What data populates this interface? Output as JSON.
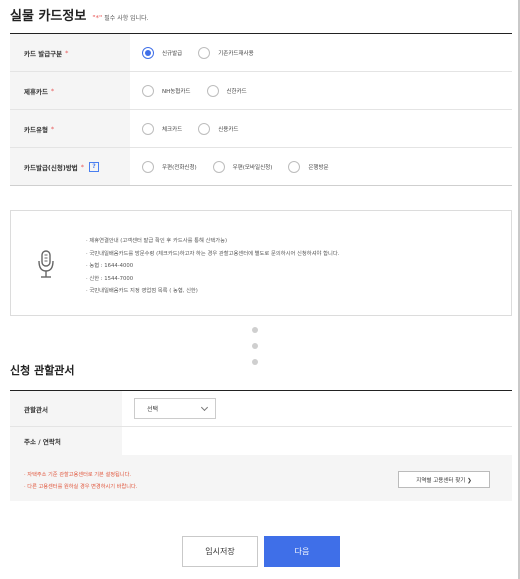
{
  "card_section": {
    "title": "실물 카드정보",
    "required_mark": "\"*\"",
    "required_text": "필수 사항 입니다."
  },
  "form_rows": [
    {
      "label": "카드 발급구분",
      "star": "*",
      "options": [
        {
          "label": "신규발급",
          "selected": true
        },
        {
          "label": "기존카드재사용",
          "selected": false
        }
      ]
    },
    {
      "label": "제휴카드",
      "star": "*",
      "options": [
        {
          "label": "NH농협카드",
          "selected": false
        },
        {
          "label": "신한카드",
          "selected": false
        }
      ]
    },
    {
      "label": "카드유형",
      "star": "*",
      "options": [
        {
          "label": "체크카드",
          "selected": false
        },
        {
          "label": "신용카드",
          "selected": false
        }
      ]
    },
    {
      "label": "카드발급(신청)방법",
      "star": "*",
      "help": "?",
      "options": [
        {
          "label": "우편(전화신청)",
          "selected": false
        },
        {
          "label": "우편(모바일신청)",
          "selected": false
        },
        {
          "label": "은행방문",
          "selected": false
        }
      ]
    }
  ],
  "info": {
    "icon": "microphone-icon",
    "lines": [
      "· 제휴연결안내 (고객센터 발급 확인 후 카드사를 통해 신택가능)",
      "· 국민내일배움카드를 방문수령 (체크카드)하고자 하는 경우 관할고용센터에 별도로 문의하시어 신청하셔야 합니다.",
      "· 농협 : 1644-4000",
      "· 신한 : 1544-7000",
      "· 국민내일배움카드 지정 영업점 목록 ( 농협, 신한)"
    ]
  },
  "office_section": {
    "title": "신청 관할관서",
    "office_label": "관할관서",
    "select_value": "선택",
    "address_label": "주소 / 연락처",
    "address_value": ""
  },
  "notes": {
    "line1": "· 자택주소 기준 관할고용센터로 기본 설정됩니다.",
    "line2": "· 다른 고용센터를 원하실 경우 변경하시기 바랍니다.",
    "find_button": "지역별 고용센터 찾기 ❯"
  },
  "buttons": {
    "save": "임시저장",
    "next": "다음"
  },
  "colors": {
    "accent": "#3f6fe8",
    "required": "#e85a5a",
    "note": "#e0553b"
  }
}
